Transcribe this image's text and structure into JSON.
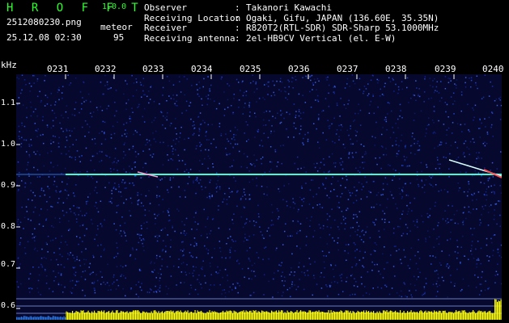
{
  "app": {
    "title": "H R O F F T",
    "version": "1.0.0"
  },
  "file": {
    "name": "2512080230.png",
    "datetime": "25.12.08 02:30"
  },
  "detection": {
    "label": "meteor",
    "count": "95"
  },
  "info": [
    {
      "key": "Observer",
      "value": "Takanori Kawachi"
    },
    {
      "key": "Receiving Location",
      "value": "Ogaki, Gifu, JAPAN (136.60E, 35.35N)"
    },
    {
      "key": "Receiver",
      "value": "R820T2(RTL-SDR) SDR-Sharp 53.1000MHz"
    },
    {
      "key": "Receiving antenna",
      "value": "2el-HB9CV Vertical (el. E-W)"
    }
  ],
  "info_sep": ":",
  "axis": {
    "unit": "kHz",
    "y_ticks": [
      "1.1",
      "1.0",
      "0.9",
      "0.8",
      "0.7",
      "0.6"
    ],
    "time_ticks": [
      "0231",
      "0232",
      "0233",
      "0234",
      "0235",
      "0236",
      "0237",
      "0238",
      "0239",
      "0240"
    ]
  },
  "colors": {
    "title": "#2bff2b",
    "carrier": "#3fffd0",
    "level_bars": "#ffff00"
  }
}
